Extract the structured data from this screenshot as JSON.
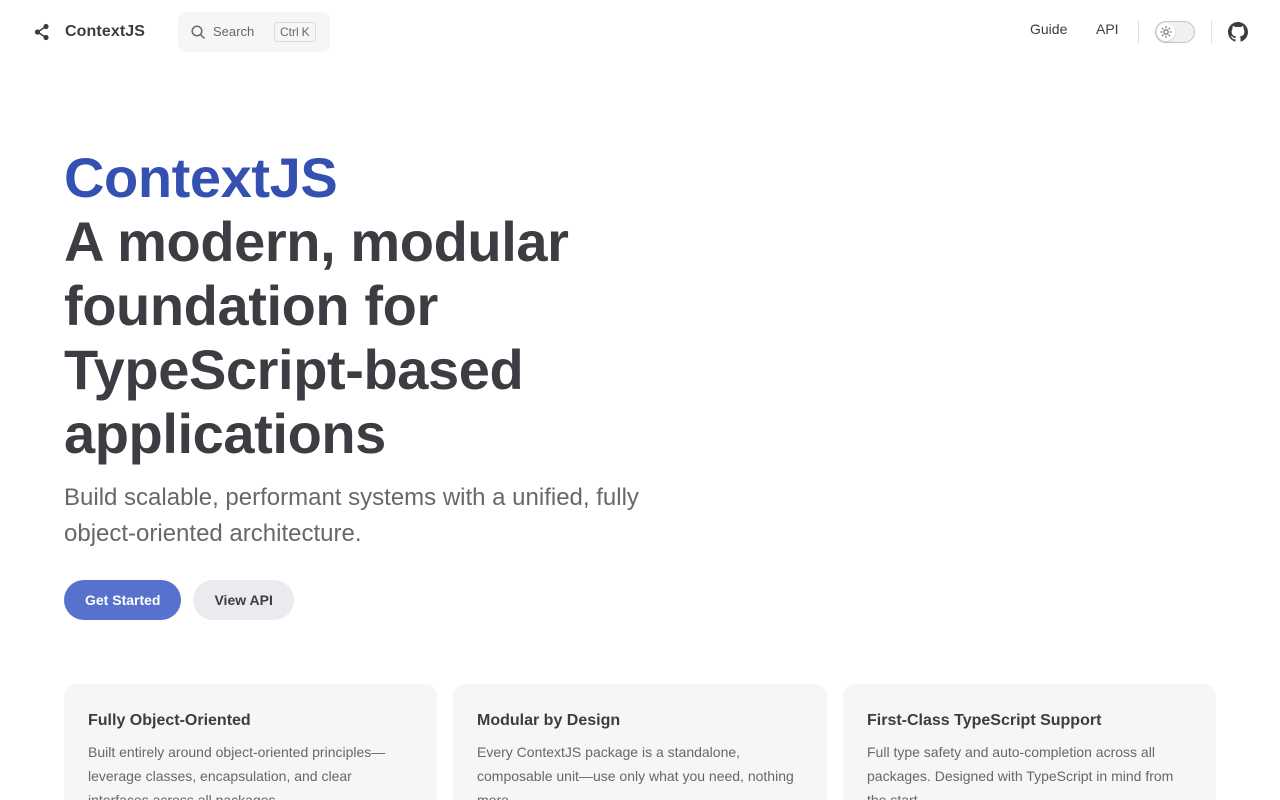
{
  "nav": {
    "site_title": "ContextJS",
    "search_label": "Search",
    "search_kbd_ctrl": "Ctrl",
    "search_kbd_key": "K",
    "links": [
      {
        "label": "Guide"
      },
      {
        "label": "API"
      }
    ],
    "appearance_icon": "sun-icon",
    "social_icon": "github-icon"
  },
  "hero": {
    "name": "ContextJS",
    "tagline": "A modern, modular foundation for TypeScript-based applications",
    "text": "Build scalable, performant systems with a unified, fully object-oriented architecture.",
    "actions": [
      {
        "label": "Get Started",
        "theme": "brand"
      },
      {
        "label": "View API",
        "theme": "alt"
      }
    ]
  },
  "features": [
    {
      "title": "Fully Object-Oriented",
      "details": "Built entirely around object-oriented principles—leverage classes, encapsulation, and clear interfaces across all packages."
    },
    {
      "title": "Modular by Design",
      "details": "Every ContextJS package is a standalone, composable unit—use only what you need, nothing more."
    },
    {
      "title": "First-Class TypeScript Support",
      "details": "Full type safety and auto-completion across all packages. Designed with TypeScript in mind from the start."
    }
  ],
  "colors": {
    "brand": "#3451b2",
    "brand_button": "#5672cd",
    "text": "#3c3c43",
    "muted": "#67676c",
    "card_bg": "#f6f6f7"
  }
}
